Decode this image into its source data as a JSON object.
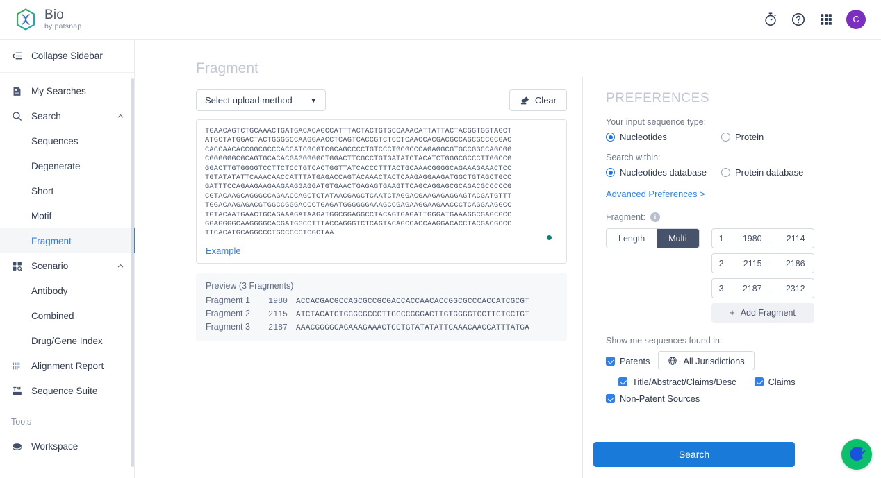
{
  "header": {
    "brand_title": "Bio",
    "brand_sub": "by patsnap",
    "icons": [
      "timer-icon",
      "help-icon",
      "apps-grid-icon"
    ],
    "avatar_initial": "C"
  },
  "sidebar": {
    "collapse_label": "Collapse Sidebar",
    "items": [
      {
        "label": "My Searches",
        "icon": "document-icon",
        "type": "top"
      },
      {
        "label": "Search",
        "icon": "search-icon",
        "type": "group",
        "expanded": true
      },
      {
        "label": "Sequences",
        "type": "sub"
      },
      {
        "label": "Degenerate",
        "type": "sub"
      },
      {
        "label": "Short",
        "type": "sub"
      },
      {
        "label": "Motif",
        "type": "sub"
      },
      {
        "label": "Fragment",
        "type": "sub",
        "active": true
      },
      {
        "label": "Scenario",
        "icon": "scenario-icon",
        "type": "group",
        "expanded": true
      },
      {
        "label": "Antibody",
        "type": "sub"
      },
      {
        "label": "Combined",
        "type": "sub"
      },
      {
        "label": "Drug/Gene Index",
        "type": "sub"
      },
      {
        "label": "Alignment Report",
        "icon": "alignment-icon",
        "type": "top"
      },
      {
        "label": "Sequence Suite",
        "icon": "suite-icon",
        "type": "top"
      }
    ],
    "tools_label": "Tools",
    "tools_items": [
      {
        "label": "Workspace",
        "icon": "workspace-icon"
      }
    ]
  },
  "main": {
    "page_title": "Fragment",
    "upload_method_label": "Select upload method",
    "clear_label": "Clear",
    "example_label": "Example",
    "sequence_value": "TGAACAGTCTGCAAACTGATGACACAGCCATTTACTACTGTGCCAAACATTATTACTACGGTGGTAGCT\nATGCTATGGACTACTGGGGCCAAGGAACCTCAGTCACCGTCTCCTCAACCACGACGCCAGCGCCGCGAC\nCACCAACACCGGCGCCCACCATCGCGTCGCAGCCCCTGTCCCTGCGCCCAGAGGCGTGCCGGCCAGCGG\nCGGGGGGCGCAGTGCACACGAGGGGGCTGGACTTCGCCTGTGATATCTACATCTGGGCGCCCTTGGCCG\nGGACTTGTGGGGTCCTTCTCCTGTCACTGGTTATCACCCTTTACTGCAAACGGGGCAGAAAGAAACTCC\nTGTATATATTCAAACAACCATTTATGAGACCAGTACAAACTACTCAAGAGGAAGATGGCTGTAGCTGCC\nGATTTCCAGAAGAAGAAGAAGGAGGATGTGAACTGAGAGTGAAGTTCAGCAGGAGCGCAGACGCCCCCG\nCGTACAAGCAGGGCCAGAACCAGCTCTATAACGAGCTCAATCTAGGACGAAGAGAGGAGTACGATGTTT\nTGGACAAGAGACGTGGCCGGGACCCTGAGATGGGGGGAAAGCCGAGAAGGAAGAACCCTCAGGAAGGCC\nTGTACAATGAACTGCAGAAAGATAAGATGGCGGAGGCCTACAGTGAGATTGGGATGAAAGGCGAGCGCC\nGGAGGGGCAAGGGGCACGATGGCCTTTACCAGGGTCTCAGTACAGCCACCAAGGACACCTACGACGCCC\nTTCACATGCAGGCCCTGCCCCCTCGCTAA",
    "preview": {
      "title": "Preview (3 Fragments)",
      "rows": [
        {
          "name": "Fragment 1",
          "pos": "1980",
          "seq": "ACCACGACGCCAGCGCCGCGACCACCAACACCGGCGCCCACCATCGCGT"
        },
        {
          "name": "Fragment 2",
          "pos": "2115",
          "seq": "ATCTACATCTGGGCGCCCTTGGCCGGGACTTGTGGGGTCCTTCTCCTGT"
        },
        {
          "name": "Fragment 3",
          "pos": "2187",
          "seq": "AAACGGGGCAGAAAGAAACTCCTGTATATATTCAAACAACCATTTATGA"
        }
      ]
    }
  },
  "preferences": {
    "title": "PREFERENCES",
    "input_type_label": "Your input sequence type:",
    "input_type_options": [
      {
        "label": "Nucleotides",
        "selected": true
      },
      {
        "label": "Protein",
        "selected": false
      }
    ],
    "search_within_label": "Search within:",
    "search_within_options": [
      {
        "label": "Nucleotides database",
        "selected": true
      },
      {
        "label": "Protein database",
        "selected": false
      }
    ],
    "advanced_link": "Advanced Preferences >",
    "fragment_label": "Fragment:",
    "mode_options": [
      {
        "label": "Length",
        "selected": false
      },
      {
        "label": "Multi",
        "selected": true
      }
    ],
    "fragments": [
      {
        "index": "1",
        "start": "1980",
        "dash": "-",
        "end": "2114"
      },
      {
        "index": "2",
        "start": "2115",
        "dash": "-",
        "end": "2186"
      },
      {
        "index": "3",
        "start": "2187",
        "dash": "-",
        "end": "2312"
      }
    ],
    "add_fragment_label": "Add Fragment",
    "add_fragment_plus": "+",
    "found_in_label": "Show me sequences found in:",
    "patents_label": "Patents",
    "patents_checked": true,
    "jurisdictions_label": "All Jurisdictions",
    "title_abstract_label": "Title/Abstract/Claims/Desc",
    "title_abstract_checked": true,
    "claims_label": "Claims",
    "claims_checked": true,
    "non_patent_label": "Non-Patent Sources",
    "non_patent_checked": true,
    "search_button_label": "Search"
  },
  "colors": {
    "accent_blue": "#2f80ed",
    "primary_button": "#1a7ad9",
    "avatar_purple": "#7b2fbe",
    "fab_green": "#0cbf6a",
    "fab_blue": "#1a52e0",
    "seq_dot_teal": "#0f8074"
  }
}
